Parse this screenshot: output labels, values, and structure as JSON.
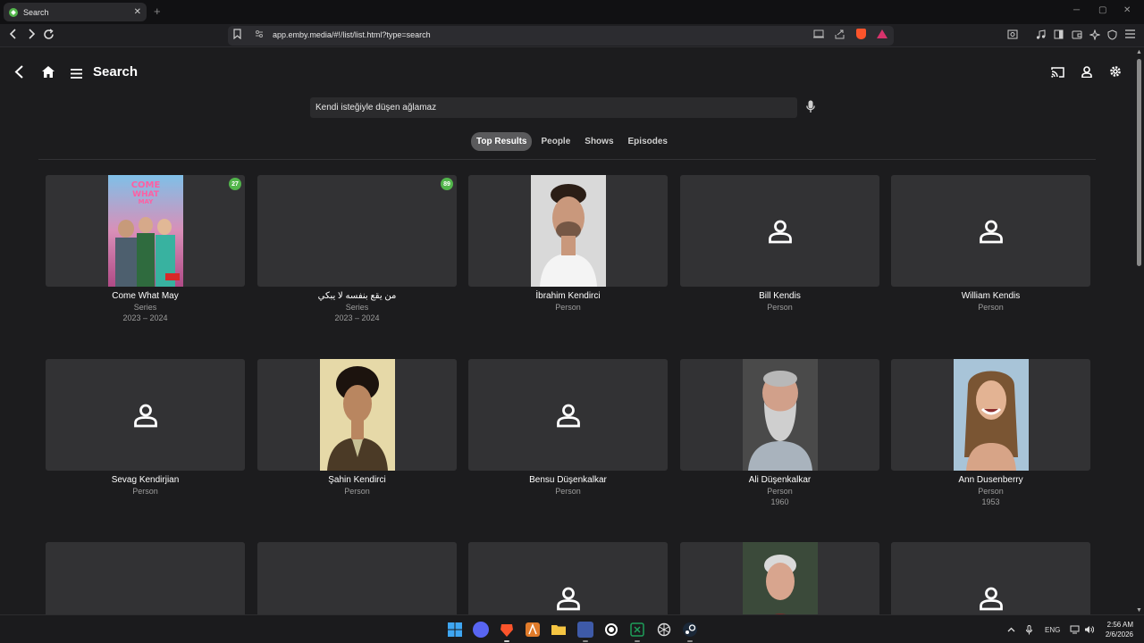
{
  "browser": {
    "tab_title": "Search",
    "tab_close": "✕",
    "new_tab": "+",
    "url": "app.emby.media/#!/list/list.html?type=search",
    "win_min": "─",
    "win_max": "▢",
    "win_close": "✕"
  },
  "app": {
    "title": "Search"
  },
  "search": {
    "value": "Kendi isteğiyle düşen ağlamaz"
  },
  "filters": [
    {
      "label": "Top Results",
      "active": true
    },
    {
      "label": "People"
    },
    {
      "label": "Shows"
    },
    {
      "label": "Episodes"
    }
  ],
  "results": [
    {
      "title": "Come What May",
      "type": "Series",
      "years": "2023 – 2024",
      "badge": "27",
      "image": "poster"
    },
    {
      "title": "من يقع بنفسه لا يبكي",
      "type": "Series",
      "years": "2023 – 2024",
      "badge": "89",
      "image": "none"
    },
    {
      "title": "İbrahim Kendirci",
      "type": "Person",
      "years": "",
      "image": "photo"
    },
    {
      "title": "Bill Kendis",
      "type": "Person",
      "years": "",
      "image": "placeholder"
    },
    {
      "title": "William Kendis",
      "type": "Person",
      "years": "",
      "image": "placeholder"
    },
    {
      "title": "Sevag Kendirjian",
      "type": "Person",
      "years": "",
      "image": "placeholder"
    },
    {
      "title": "Şahin Kendirci",
      "type": "Person",
      "years": "",
      "image": "photo"
    },
    {
      "title": "Bensu Düşenkalkar",
      "type": "Person",
      "years": "",
      "image": "placeholder"
    },
    {
      "title": "Ali Düşenkalkar",
      "type": "Person",
      "years": "1960",
      "image": "photo"
    },
    {
      "title": "Ann Dusenberry",
      "type": "Person",
      "years": "1953",
      "image": "photo"
    }
  ],
  "taskbar": {
    "lang": "ENG",
    "time": "2:56 AM",
    "date": "2/6/2026"
  },
  "colors": {
    "accent": "#52b54b",
    "background": "#1c1c1e",
    "card": "#323234"
  }
}
